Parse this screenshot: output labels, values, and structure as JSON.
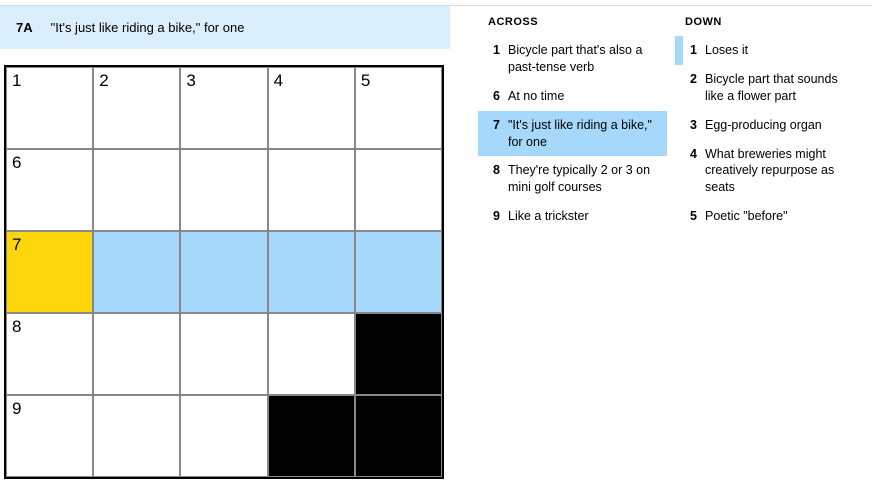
{
  "current_clue": {
    "label": "7A",
    "text": "\"It's just like riding a bike,\" for one"
  },
  "grid": {
    "rows": 5,
    "cols": 5,
    "cells": [
      [
        {
          "num": "1"
        },
        {
          "num": "2"
        },
        {
          "num": "3"
        },
        {
          "num": "4"
        },
        {
          "num": "5"
        }
      ],
      [
        {
          "num": "6"
        },
        {},
        {},
        {},
        {}
      ],
      [
        {
          "num": "7",
          "focus": true
        },
        {
          "sel": true
        },
        {
          "sel": true
        },
        {
          "sel": true
        },
        {
          "sel": true
        }
      ],
      [
        {
          "num": "8"
        },
        {},
        {},
        {},
        {
          "black": true
        }
      ],
      [
        {
          "num": "9"
        },
        {},
        {},
        {
          "black": true
        },
        {
          "black": true
        }
      ]
    ]
  },
  "lists": {
    "across": {
      "title": "ACROSS",
      "clues": [
        {
          "num": "1",
          "text": "Bicycle part that's also a past-tense verb"
        },
        {
          "num": "6",
          "text": "At no time"
        },
        {
          "num": "7",
          "text": "\"It's just like riding a bike,\" for one",
          "active": true
        },
        {
          "num": "8",
          "text": "They're typically 2 or 3 on mini golf courses"
        },
        {
          "num": "9",
          "text": "Like a trickster"
        }
      ]
    },
    "down": {
      "title": "DOWN",
      "clues": [
        {
          "num": "1",
          "text": "Loses it",
          "marker": true
        },
        {
          "num": "2",
          "text": "Bicycle part that sounds like a flower part"
        },
        {
          "num": "3",
          "text": "Egg-producing organ"
        },
        {
          "num": "4",
          "text": "What breweries might creatively repurpose as seats"
        },
        {
          "num": "5",
          "text": "Poetic \"before\""
        }
      ]
    }
  }
}
